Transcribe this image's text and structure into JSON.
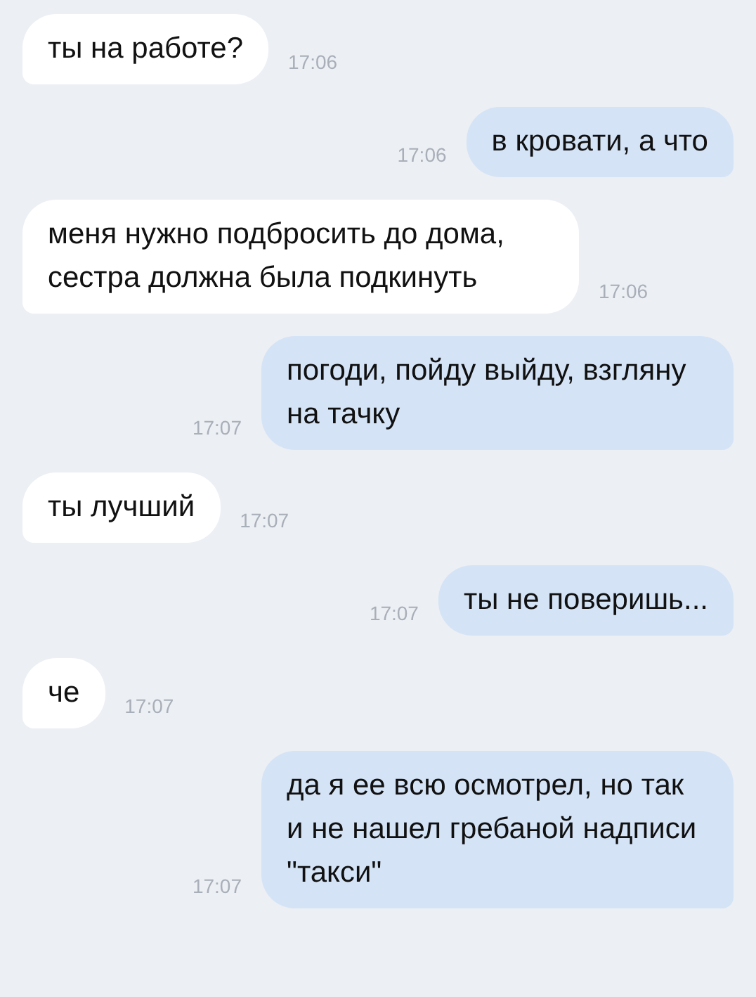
{
  "messages": [
    {
      "kind": "incoming",
      "text": "ты на работе?",
      "time": "17:06"
    },
    {
      "kind": "outgoing",
      "text": "в кровати, а что",
      "time": "17:06"
    },
    {
      "kind": "incoming",
      "text": "меня нужно подбросить до дома, сестра должна была подкинуть",
      "time": "17:06"
    },
    {
      "kind": "outgoing",
      "text": "погоди, пойду выйду, взгляну на тачку",
      "time": "17:07"
    },
    {
      "kind": "incoming",
      "text": "ты лучший",
      "time": "17:07"
    },
    {
      "kind": "outgoing",
      "text": "ты не поверишь...",
      "time": "17:07"
    },
    {
      "kind": "incoming",
      "text": "че",
      "time": "17:07"
    },
    {
      "kind": "outgoing",
      "text": "да я ее всю осмотрел, но так и не нашел гребаной надписи \"такси\"",
      "time": "17:07"
    }
  ]
}
